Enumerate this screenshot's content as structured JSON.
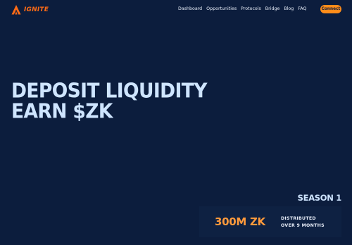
{
  "brand": {
    "name": "IGNITE",
    "logo_icon": "flame-a-icon",
    "color": "#ff6b16"
  },
  "nav": {
    "items": [
      {
        "label": "Dashboard"
      },
      {
        "label": "Opportunities"
      },
      {
        "label": "Protocols"
      },
      {
        "label": "Bridge"
      },
      {
        "label": "Blog"
      },
      {
        "label": "FAQ"
      }
    ],
    "connect_label": "Connect"
  },
  "hero": {
    "line1": "DEPOSIT LIQUIDITY",
    "line2": "EARN $ZK"
  },
  "season": {
    "label": "SEASON 1"
  },
  "stats": {
    "amount": "300M ZK",
    "desc_line1": "DISTRIBUTED",
    "desc_line2": "OVER 9 MONTHS"
  },
  "colors": {
    "background": "#0c1d3d",
    "accent": "#ff8c1a",
    "headline": "#cfe5ff"
  }
}
